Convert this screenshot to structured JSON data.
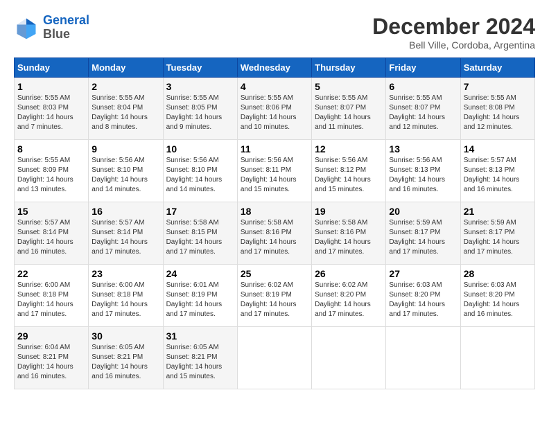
{
  "header": {
    "logo_line1": "General",
    "logo_line2": "Blue",
    "month": "December 2024",
    "location": "Bell Ville, Cordoba, Argentina"
  },
  "weekdays": [
    "Sunday",
    "Monday",
    "Tuesday",
    "Wednesday",
    "Thursday",
    "Friday",
    "Saturday"
  ],
  "weeks": [
    [
      {
        "day": 1,
        "sunrise": "5:55 AM",
        "sunset": "8:03 PM",
        "daylight": "14 hours and 7 minutes."
      },
      {
        "day": 2,
        "sunrise": "5:55 AM",
        "sunset": "8:04 PM",
        "daylight": "14 hours and 8 minutes."
      },
      {
        "day": 3,
        "sunrise": "5:55 AM",
        "sunset": "8:05 PM",
        "daylight": "14 hours and 9 minutes."
      },
      {
        "day": 4,
        "sunrise": "5:55 AM",
        "sunset": "8:06 PM",
        "daylight": "14 hours and 10 minutes."
      },
      {
        "day": 5,
        "sunrise": "5:55 AM",
        "sunset": "8:07 PM",
        "daylight": "14 hours and 11 minutes."
      },
      {
        "day": 6,
        "sunrise": "5:55 AM",
        "sunset": "8:07 PM",
        "daylight": "14 hours and 12 minutes."
      },
      {
        "day": 7,
        "sunrise": "5:55 AM",
        "sunset": "8:08 PM",
        "daylight": "14 hours and 12 minutes."
      }
    ],
    [
      {
        "day": 8,
        "sunrise": "5:55 AM",
        "sunset": "8:09 PM",
        "daylight": "14 hours and 13 minutes."
      },
      {
        "day": 9,
        "sunrise": "5:56 AM",
        "sunset": "8:10 PM",
        "daylight": "14 hours and 14 minutes."
      },
      {
        "day": 10,
        "sunrise": "5:56 AM",
        "sunset": "8:10 PM",
        "daylight": "14 hours and 14 minutes."
      },
      {
        "day": 11,
        "sunrise": "5:56 AM",
        "sunset": "8:11 PM",
        "daylight": "14 hours and 15 minutes."
      },
      {
        "day": 12,
        "sunrise": "5:56 AM",
        "sunset": "8:12 PM",
        "daylight": "14 hours and 15 minutes."
      },
      {
        "day": 13,
        "sunrise": "5:56 AM",
        "sunset": "8:13 PM",
        "daylight": "14 hours and 16 minutes."
      },
      {
        "day": 14,
        "sunrise": "5:57 AM",
        "sunset": "8:13 PM",
        "daylight": "14 hours and 16 minutes."
      }
    ],
    [
      {
        "day": 15,
        "sunrise": "5:57 AM",
        "sunset": "8:14 PM",
        "daylight": "14 hours and 16 minutes."
      },
      {
        "day": 16,
        "sunrise": "5:57 AM",
        "sunset": "8:14 PM",
        "daylight": "14 hours and 17 minutes."
      },
      {
        "day": 17,
        "sunrise": "5:58 AM",
        "sunset": "8:15 PM",
        "daylight": "14 hours and 17 minutes."
      },
      {
        "day": 18,
        "sunrise": "5:58 AM",
        "sunset": "8:16 PM",
        "daylight": "14 hours and 17 minutes."
      },
      {
        "day": 19,
        "sunrise": "5:58 AM",
        "sunset": "8:16 PM",
        "daylight": "14 hours and 17 minutes."
      },
      {
        "day": 20,
        "sunrise": "5:59 AM",
        "sunset": "8:17 PM",
        "daylight": "14 hours and 17 minutes."
      },
      {
        "day": 21,
        "sunrise": "5:59 AM",
        "sunset": "8:17 PM",
        "daylight": "14 hours and 17 minutes."
      }
    ],
    [
      {
        "day": 22,
        "sunrise": "6:00 AM",
        "sunset": "8:18 PM",
        "daylight": "14 hours and 17 minutes."
      },
      {
        "day": 23,
        "sunrise": "6:00 AM",
        "sunset": "8:18 PM",
        "daylight": "14 hours and 17 minutes."
      },
      {
        "day": 24,
        "sunrise": "6:01 AM",
        "sunset": "8:19 PM",
        "daylight": "14 hours and 17 minutes."
      },
      {
        "day": 25,
        "sunrise": "6:02 AM",
        "sunset": "8:19 PM",
        "daylight": "14 hours and 17 minutes."
      },
      {
        "day": 26,
        "sunrise": "6:02 AM",
        "sunset": "8:20 PM",
        "daylight": "14 hours and 17 minutes."
      },
      {
        "day": 27,
        "sunrise": "6:03 AM",
        "sunset": "8:20 PM",
        "daylight": "14 hours and 17 minutes."
      },
      {
        "day": 28,
        "sunrise": "6:03 AM",
        "sunset": "8:20 PM",
        "daylight": "14 hours and 16 minutes."
      }
    ],
    [
      {
        "day": 29,
        "sunrise": "6:04 AM",
        "sunset": "8:21 PM",
        "daylight": "14 hours and 16 minutes."
      },
      {
        "day": 30,
        "sunrise": "6:05 AM",
        "sunset": "8:21 PM",
        "daylight": "14 hours and 16 minutes."
      },
      {
        "day": 31,
        "sunrise": "6:05 AM",
        "sunset": "8:21 PM",
        "daylight": "14 hours and 15 minutes."
      },
      null,
      null,
      null,
      null
    ]
  ]
}
